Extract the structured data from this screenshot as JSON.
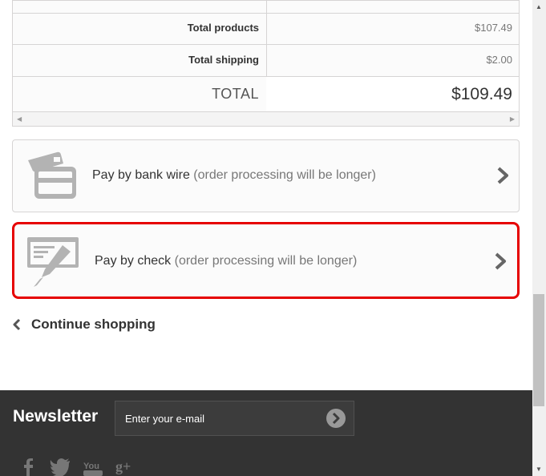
{
  "cart_summary": {
    "total_products_label": "Total products",
    "total_products_value": "$107.49",
    "total_shipping_label": "Total shipping",
    "total_shipping_value": "$2.00",
    "total_label": "TOTAL",
    "total_value": "$109.49"
  },
  "payment_options": [
    {
      "icon": "bank-card-icon",
      "name": "Pay by bank wire",
      "note": "(order processing will be longer)"
    },
    {
      "icon": "check-icon",
      "name": "Pay by check",
      "note": "(order processing will be longer)"
    }
  ],
  "continue_shopping": {
    "label": "Continue shopping"
  },
  "footer": {
    "newsletter_title": "Newsletter",
    "newsletter_placeholder": "Enter your e-mail",
    "social": [
      "facebook-icon",
      "twitter-icon",
      "youtube-icon",
      "google-plus-icon"
    ]
  },
  "colors": {
    "selected_border": "#e60000",
    "footer_bg": "#333333"
  }
}
